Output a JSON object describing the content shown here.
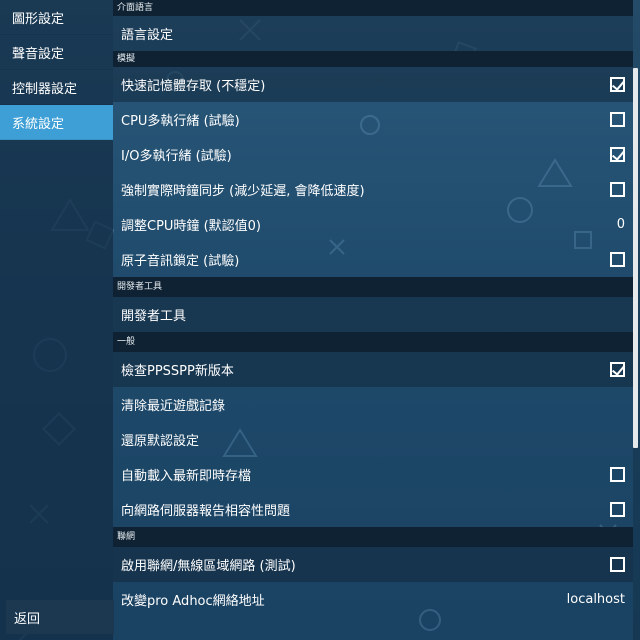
{
  "sidebar": {
    "items": [
      {
        "label": "圖形設定",
        "active": false
      },
      {
        "label": "聲音設定",
        "active": false
      },
      {
        "label": "控制器設定",
        "active": false
      },
      {
        "label": "系統設定",
        "active": true
      }
    ],
    "back_label": "返回"
  },
  "sections": {
    "ui_language": {
      "header": "介面語言",
      "language_settings": "語言設定"
    },
    "emulation": {
      "header": "模擬",
      "fast_memory": {
        "label": "快速記憶體存取 (不穩定)",
        "checked": true
      },
      "cpu_multithread": {
        "label": "CPU多執行緒 (試驗)",
        "checked": false
      },
      "io_multithread": {
        "label": "I/O多執行緒 (試驗)",
        "checked": true
      },
      "force_realtime_clock": {
        "label": "強制實際時鐘同步 (減少延遲, 會降低速度)",
        "checked": false
      },
      "cpu_clock": {
        "label": "調整CPU時鐘 (默認值0)",
        "value": "0"
      },
      "atomic_audio_locks": {
        "label": "原子音訊鎖定 (試驗)",
        "checked": false
      }
    },
    "developer_tools": {
      "header": "開發者工具",
      "developer_tools": "開發者工具"
    },
    "general": {
      "header": "一般",
      "check_new_version": {
        "label": "檢查PPSSPP新版本",
        "checked": true
      },
      "clear_recent": "清除最近遊戲記錄",
      "restore_defaults": "還原默認設定",
      "auto_load_savestate": {
        "label": "自動載入最新即時存檔",
        "checked": false
      },
      "report_compat": {
        "label": "向網路伺服器報告相容性問題",
        "checked": false
      }
    },
    "networking": {
      "header": "聯網",
      "enable_networking": {
        "label": "啟用聯網/無線區域網路 (測試)",
        "checked": false
      },
      "pro_adhoc_address": {
        "label": "改變pro Adhoc網絡地址",
        "value": "localhost"
      }
    }
  },
  "colors": {
    "background_top": "#2b5a7c",
    "background_bottom": "#1a4262",
    "sidebar_active": "#3d9fd6",
    "section_header": "#0f2233"
  }
}
